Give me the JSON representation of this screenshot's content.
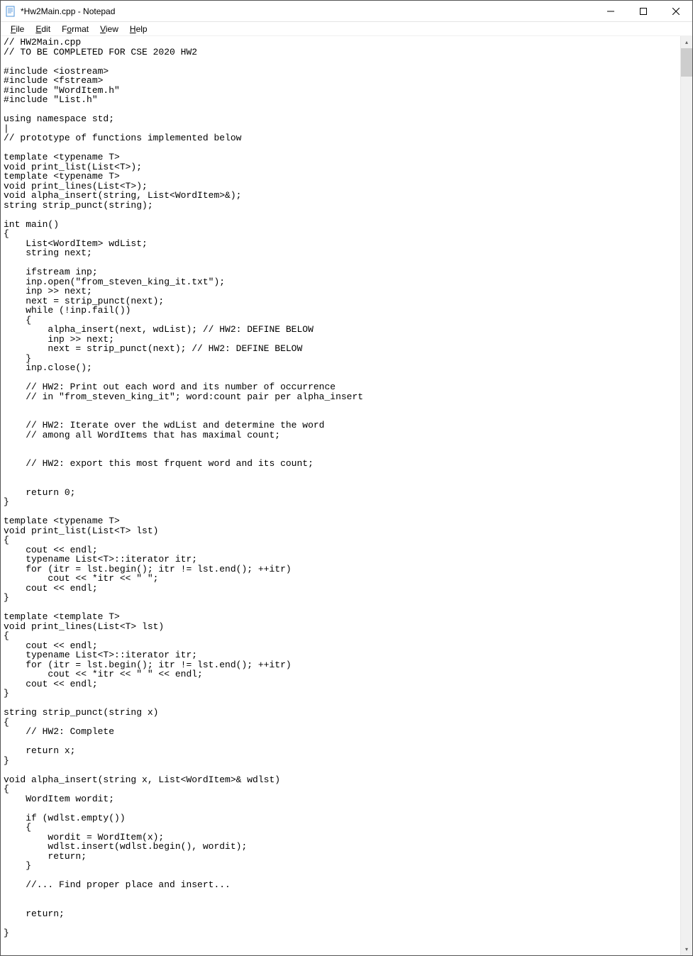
{
  "window": {
    "title": "*Hw2Main.cpp - Notepad"
  },
  "menu": {
    "file": "File",
    "edit": "Edit",
    "format": "Format",
    "view": "View",
    "help": "Help"
  },
  "editor": {
    "content": "// HW2Main.cpp\n// TO BE COMPLETED FOR CSE 2020 HW2\n\n#include <iostream>\n#include <fstream>\n#include \"WordItem.h\"\n#include \"List.h\"\n\nusing namespace std;\n|\n// prototype of functions implemented below\n\ntemplate <typename T>\nvoid print_list(List<T>);\ntemplate <typename T>\nvoid print_lines(List<T>);\nvoid alpha_insert(string, List<WordItem>&);\nstring strip_punct(string);\n\nint main()\n{\n    List<WordItem> wdList;\n    string next;\n\n    ifstream inp;\n    inp.open(\"from_steven_king_it.txt\");\n    inp >> next;\n    next = strip_punct(next);\n    while (!inp.fail())\n    {\n        alpha_insert(next, wdList); // HW2: DEFINE BELOW\n        inp >> next;\n        next = strip_punct(next); // HW2: DEFINE BELOW\n    }\n    inp.close();\n\n    // HW2: Print out each word and its number of occurrence\n    // in \"from_steven_king_it\"; word:count pair per alpha_insert\n\n\n    // HW2: Iterate over the wdList and determine the word\n    // among all WordItems that has maximal count;\n\n\n    // HW2: export this most frquent word and its count;\n\n\n    return 0;\n}\n\ntemplate <typename T>\nvoid print_list(List<T> lst)\n{\n    cout << endl;\n    typename List<T>::iterator itr;\n    for (itr = lst.begin(); itr != lst.end(); ++itr)\n        cout << *itr << \" \";\n    cout << endl;\n}\n\ntemplate <template T>\nvoid print_lines(List<T> lst)\n{\n    cout << endl;\n    typename List<T>::iterator itr;\n    for (itr = lst.begin(); itr != lst.end(); ++itr)\n        cout << *itr << \" \" << endl;\n    cout << endl;\n}\n\nstring strip_punct(string x)\n{\n    // HW2: Complete\n\n    return x;\n}\n\nvoid alpha_insert(string x, List<WordItem>& wdlst)\n{\n    WordItem wordit;\n\n    if (wdlst.empty())\n    {\n        wordit = WordItem(x);\n        wdlst.insert(wdlst.begin(), wordit);\n        return;\n    }\n\n    //... Find proper place and insert...\n\n\n    return;\n\n}"
  }
}
